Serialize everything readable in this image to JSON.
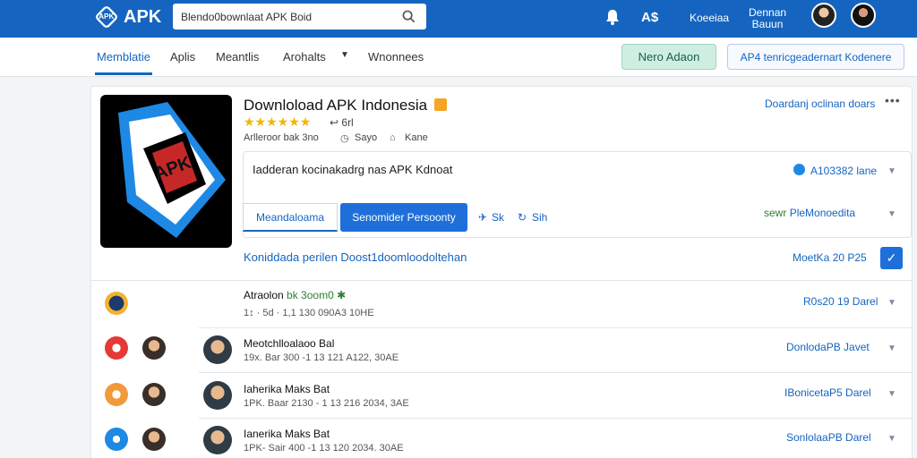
{
  "header": {
    "logo_text": "APK",
    "logo_mark": "APK",
    "search_value": "Blendo0bownlaat APK Boid",
    "search_icon": "search-icon",
    "bell_icon": "bell-icon",
    "top_label_1": "A$",
    "top_label_2": "Koeeiaa",
    "top_label_3_line1": "Dennan",
    "top_label_3_line2": "Bauun"
  },
  "nav": {
    "tabs": [
      "Memblatie",
      "Aplis",
      "Meantlis",
      "Arohalts"
    ],
    "dropdown_icon": "chevron-down-icon",
    "last_tab": "Wnonnees",
    "green_button": "Nero Adaon",
    "outline_button": "AP4 tenricgeadernart Kodenere"
  },
  "app": {
    "icon_label": "APK",
    "title": "Downloload APK Indonesia",
    "stars": "★★★★★★",
    "rating": "↩ 6rl",
    "meta_1": "Arlleroor bak 3no",
    "meta_2": "Sayo",
    "meta_3": "Kane",
    "top_link": "Doardanj oclinan doars",
    "more": "•••",
    "description": "Iadderan kocinakadrg nas APK Kdnoat",
    "version": "A103382 lane",
    "tab_button": "Meandaloama",
    "primary_button": "Senomider Persoonty",
    "link_1": "Sk",
    "link_2": "Sih",
    "green_link_prefix": "sewr",
    "green_link_blue": "PleMonoedita",
    "info_left": "Koniddada perilen  Doost1doomloodoltehan",
    "info_right": "MoetKa 20 P25",
    "check": "✓"
  },
  "rows": [
    {
      "title_a": "Atraolon",
      "title_b": "bk 3oom0 ✱",
      "meta": "1↕ · 5d · 1,1  130 090A3 10HE",
      "right": "R0s20 19 Darel"
    },
    {
      "title_a": "Meotchlloalaoo Bal",
      "title_b": "",
      "meta": "19x. Bar 300 -1 13 121 A122, 30AE",
      "right": "DonlodaPB Javet"
    },
    {
      "title_a": "Iaherika Maks Bat",
      "title_b": "",
      "meta": "1PK. Baar 2130 - 1 13 216 2034, 3AE",
      "right": "IBonicetaP5 Darel"
    },
    {
      "title_a": "Ianerika Maks Bat",
      "title_b": "",
      "meta": "1PK- Sair 400 -1 13 120 2034. 30AE",
      "right": "SonlolaaPB Darel"
    }
  ],
  "colors": {
    "primary": "#1565c0",
    "accent_button": "#1e6fd9",
    "green": "#2e7d32",
    "star": "#f5b400"
  }
}
